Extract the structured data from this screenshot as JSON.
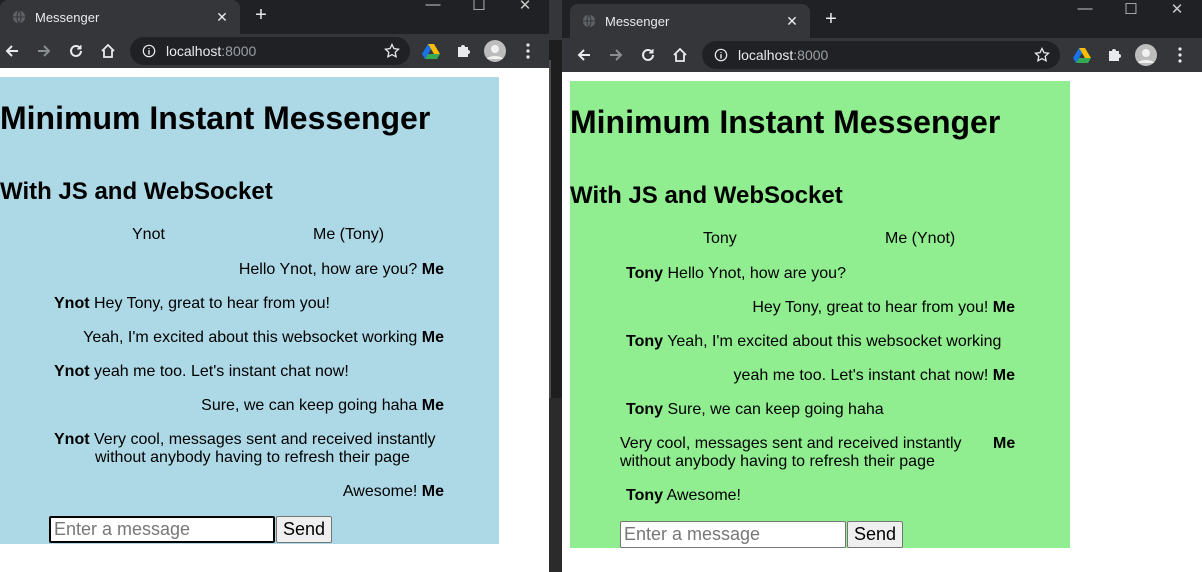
{
  "left_window": {
    "tab_title": "Messenger",
    "tab_close": "✕",
    "new_tab": "+",
    "url_host": "localhost",
    "url_port": ":8000",
    "window_controls": [
      "—",
      "☐",
      "✕"
    ],
    "page": {
      "background": "#add8e6",
      "title": "Minimum Instant Messenger",
      "subtitle": "With JS and WebSocket",
      "col_other": "Ynot",
      "col_me": "Me (Tony)",
      "messages": [
        {
          "side": "me",
          "text": "Hello Ynot, how are you?",
          "who": "Me"
        },
        {
          "side": "other",
          "who": "Ynot",
          "text": "Hey Tony, great to hear from you!"
        },
        {
          "side": "me",
          "text": "Yeah, I'm excited about this websocket working",
          "who": "Me"
        },
        {
          "side": "other",
          "who": "Ynot",
          "text": "yeah me too. Let's instant chat now!"
        },
        {
          "side": "me",
          "text": "Sure, we can keep going haha",
          "who": "Me"
        },
        {
          "side": "other",
          "who": "Ynot",
          "text": "Very cool, messages sent and received instantly",
          "text2": "without anybody having to refresh their page"
        },
        {
          "side": "me",
          "text": "Awesome!",
          "who": "Me"
        }
      ],
      "input_placeholder": "Enter a message",
      "send_label": "Send"
    }
  },
  "right_window": {
    "tab_title": "Messenger",
    "tab_close": "✕",
    "new_tab": "+",
    "url_host": "localhost",
    "url_port": ":8000",
    "window_controls": [
      "—",
      "☐",
      "✕"
    ],
    "page": {
      "background": "#90ee90",
      "title": "Minimum Instant Messenger",
      "subtitle": "With JS and WebSocket",
      "col_other": "Tony",
      "col_me": "Me (Ynot)",
      "messages": [
        {
          "side": "other",
          "who": "Tony",
          "text": "Hello Ynot, how are you?"
        },
        {
          "side": "me",
          "text": "Hey Tony, great to hear from you!",
          "who": "Me"
        },
        {
          "side": "other",
          "who": "Tony",
          "text": "Yeah, I'm excited about this websocket working"
        },
        {
          "side": "me",
          "text": "yeah me too. Let's instant chat now!",
          "who": "Me"
        },
        {
          "side": "other",
          "who": "Tony",
          "text": "Sure, we can keep going haha"
        },
        {
          "side": "me",
          "text": "Very cool, messages sent and received instantly",
          "text2": "without anybody having to refresh their page",
          "who": "Me"
        },
        {
          "side": "other",
          "who": "Tony",
          "text": "Awesome!"
        }
      ],
      "input_placeholder": "Enter a message",
      "send_label": "Send"
    }
  }
}
